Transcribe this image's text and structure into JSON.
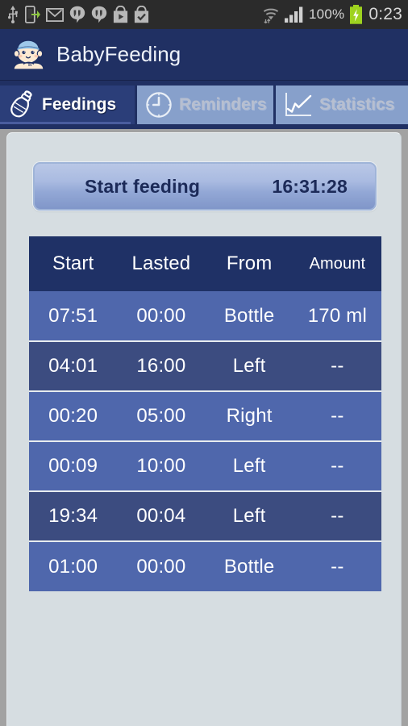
{
  "statusbar": {
    "icons": [
      "usb-icon",
      "phone-transfer-icon",
      "gmail-icon",
      "hangouts-icon",
      "hangouts-icon",
      "play-store-icon",
      "play-store-check-icon"
    ],
    "wifi_icon": "wifi-icon",
    "signal_icon": "cellular-signal-icon",
    "battery_percent": "100%",
    "battery_icon": "battery-charging-icon",
    "clock": "0:23",
    "background": "#2b2b2b"
  },
  "actionbar": {
    "title": "BabyFeeding",
    "logo_icon": "baby-face-logo",
    "background": "#203063"
  },
  "tabs": [
    {
      "label": "Feedings",
      "icon": "baby-bottle-icon",
      "active": true
    },
    {
      "label": "Reminders",
      "icon": "clock-icon",
      "active": false
    },
    {
      "label": "Statistics",
      "icon": "line-chart-icon",
      "active": false
    }
  ],
  "start_button": {
    "label": "Start feeding",
    "time": "16:31:28"
  },
  "table": {
    "columns": [
      "Start",
      "Lasted",
      "From",
      "Amount"
    ],
    "rows": [
      {
        "start": "07:51",
        "lasted": "00:00",
        "from": "Bottle",
        "amount": "170 ml",
        "shade": "light"
      },
      {
        "start": "04:01",
        "lasted": "16:00",
        "from": "Left",
        "amount": "--",
        "shade": "dark"
      },
      {
        "start": "00:20",
        "lasted": "05:00",
        "from": "Right",
        "amount": "--",
        "shade": "light"
      },
      {
        "start": "00:09",
        "lasted": "10:00",
        "from": "Left",
        "amount": "--",
        "shade": "light"
      },
      {
        "start": "19:34",
        "lasted": "00:04",
        "from": "Left",
        "amount": "--",
        "shade": "dark"
      },
      {
        "start": "01:00",
        "lasted": "00:00",
        "from": "Bottle",
        "amount": "--",
        "shade": "light"
      }
    ]
  },
  "colors": {
    "action_bar": "#203063",
    "tab_active": "#2b3e79",
    "tab_inactive": "#87a0cb",
    "panel": "#d6dde1",
    "table_header": "#1f3166",
    "row_light": "#4f67ac",
    "row_dark": "#3c4c80",
    "battery_green": "#9ed21f"
  }
}
